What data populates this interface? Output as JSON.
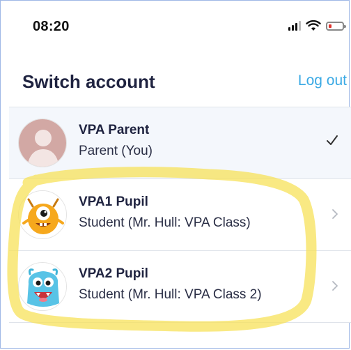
{
  "status_bar": {
    "time": "08:20",
    "icons": [
      "cellular-signal-icon",
      "wifi-icon",
      "battery-low-icon"
    ],
    "battery_color": "#e0332d"
  },
  "header": {
    "title": "Switch account",
    "logout_label": "Log out"
  },
  "accounts": [
    {
      "name": "VPA Parent",
      "role": "Parent (You)",
      "avatar": "default-person-avatar",
      "indicator": "checkmark-icon",
      "selected": true
    },
    {
      "name": "VPA1 Pupil",
      "role": "Student (Mr. Hull: VPA Class)",
      "avatar": "orange-one-eyed-monster-avatar",
      "indicator": "chevron-right-icon",
      "selected": false
    },
    {
      "name": "VPA2 Pupil",
      "role": "Student (Mr. Hull: VPA Class 2)",
      "avatar": "blue-furry-monster-avatar",
      "indicator": "chevron-right-icon",
      "selected": false
    }
  ],
  "colors": {
    "accent": "#3aa9e4",
    "title": "#1f2340",
    "highlight": "#f7e15a",
    "selected_row_bg": "#f4f7fc"
  }
}
